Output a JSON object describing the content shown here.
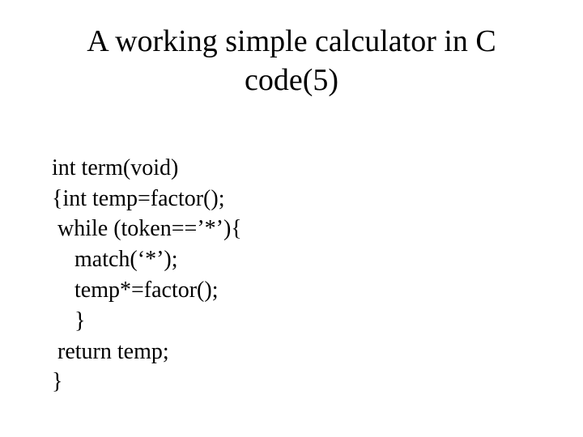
{
  "title_line1": "A working simple calculator in C",
  "title_line2": "code(5)",
  "code": {
    "l1": "int term(void)",
    "l2": "{int temp=factor();",
    "l3": " while (token==’*’){",
    "l4": "    match(‘*’);",
    "l5": "    temp*=factor();",
    "l6": "    }",
    "l7": " return temp;",
    "l8": "}"
  }
}
